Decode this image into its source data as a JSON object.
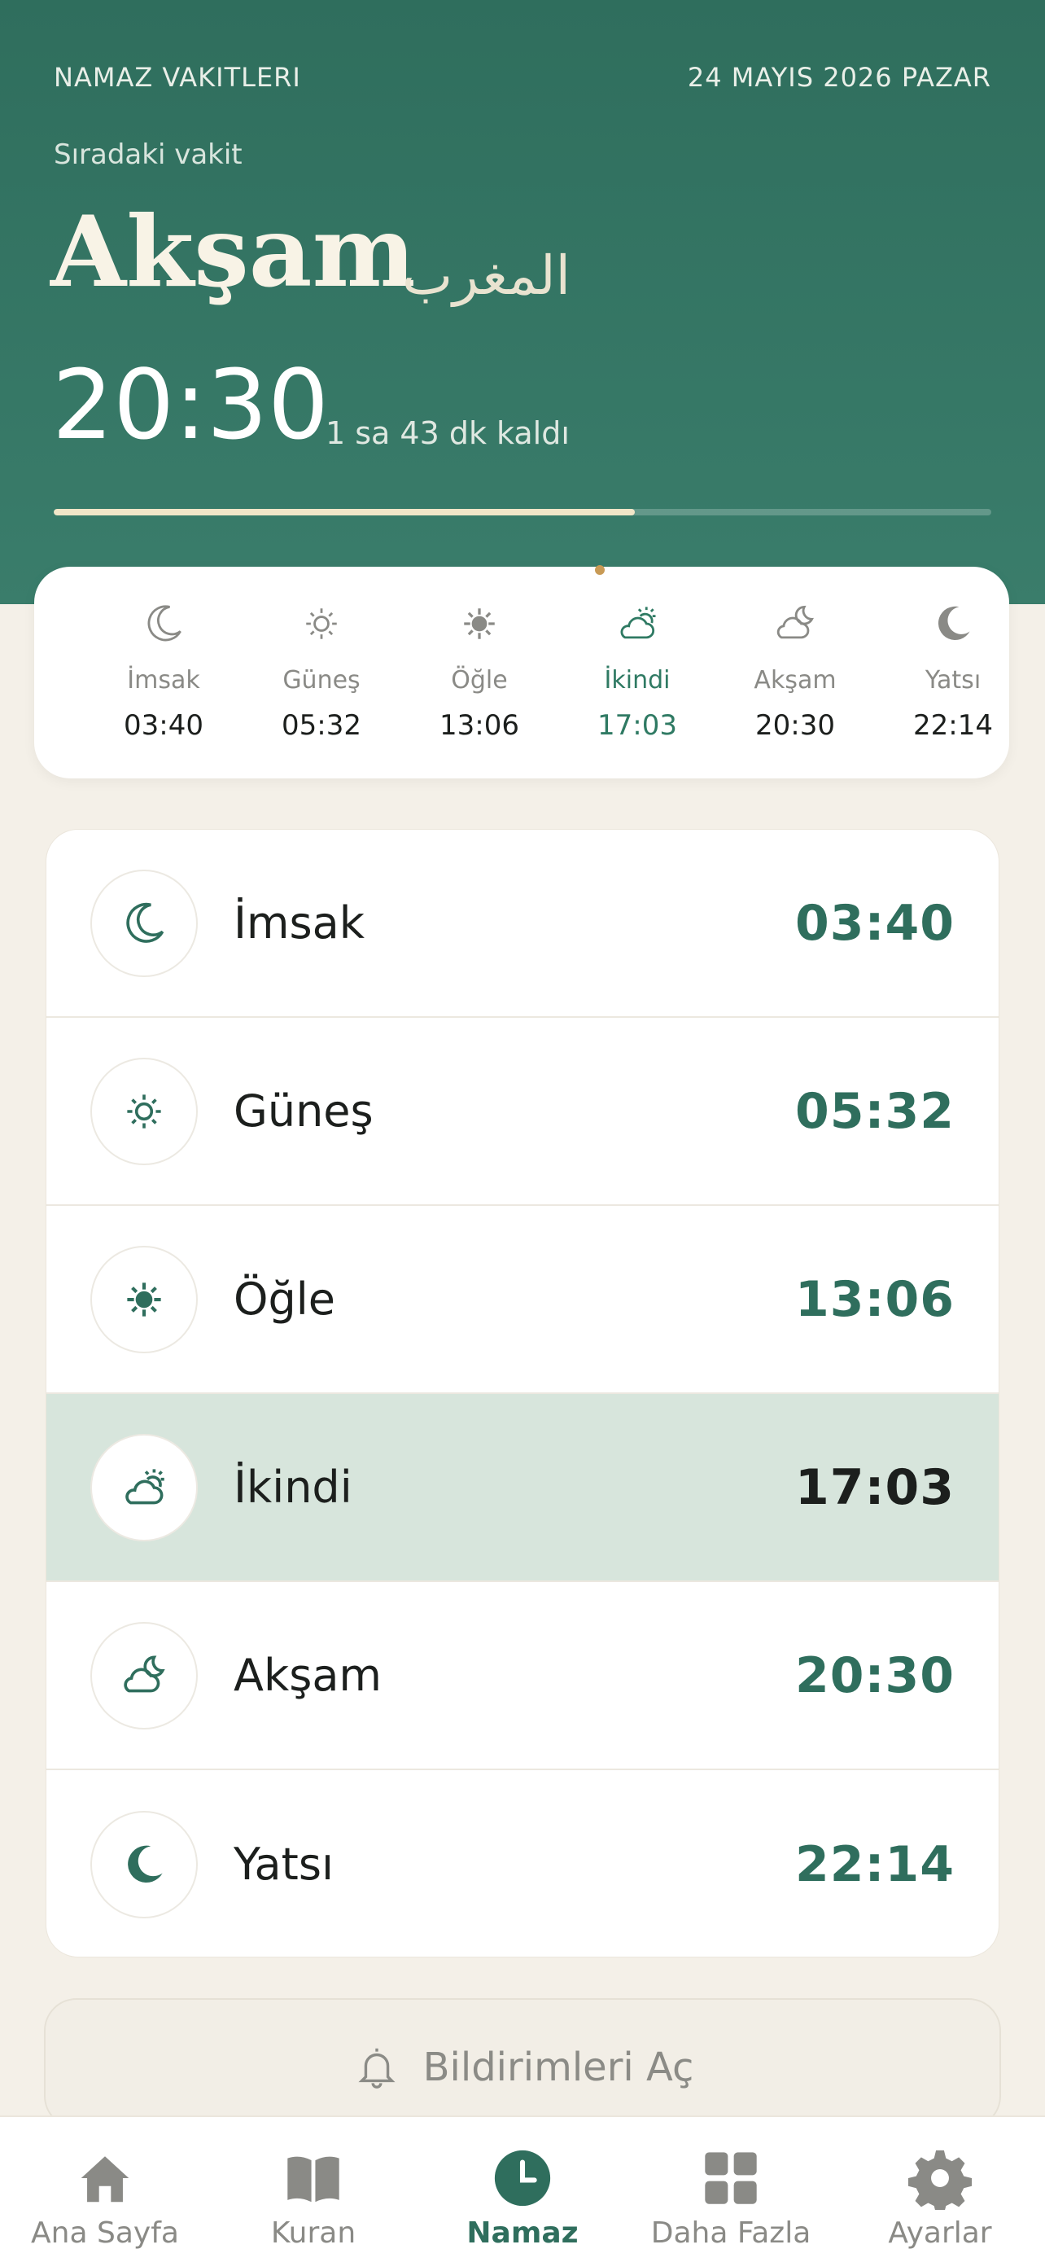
{
  "header": {
    "app_title": "NAMAZ VAKITLERI",
    "date": "24 MAYIS 2026 PAZAR",
    "next_label": "Sıradaki vakit",
    "next_name": "Akşam",
    "next_arabic": "المغرب",
    "next_time": "20:30",
    "remaining": "1 sa 43 dk kaldı",
    "progress_fraction": 0.62
  },
  "summary": [
    {
      "name": "İmsak",
      "time": "03:40",
      "icon": "crescent-moon-icon"
    },
    {
      "name": "Güneş",
      "time": "05:32",
      "icon": "sunrise-icon"
    },
    {
      "name": "Öğle",
      "time": "13:06",
      "icon": "sun-icon"
    },
    {
      "name": "İkindi",
      "time": "17:03",
      "icon": "cloud-sun-icon",
      "active": true
    },
    {
      "name": "Akşam",
      "time": "20:30",
      "icon": "cloud-moon-icon"
    },
    {
      "name": "Yatsı",
      "time": "22:14",
      "icon": "filled-moon-icon"
    }
  ],
  "prayers": [
    {
      "name": "İmsak",
      "time": "03:40",
      "icon": "crescent-moon-icon"
    },
    {
      "name": "Güneş",
      "time": "05:32",
      "icon": "sunrise-icon"
    },
    {
      "name": "Öğle",
      "time": "13:06",
      "icon": "sun-icon"
    },
    {
      "name": "İkindi",
      "time": "17:03",
      "icon": "cloud-sun-icon",
      "active": true
    },
    {
      "name": "Akşam",
      "time": "20:30",
      "icon": "cloud-moon-icon"
    },
    {
      "name": "Yatsı",
      "time": "22:14",
      "icon": "filled-moon-icon"
    }
  ],
  "notify": {
    "label": "Bildirimleri Aç",
    "icon": "bell-icon"
  },
  "tabs": [
    {
      "label": "Ana Sayfa",
      "icon": "home-icon"
    },
    {
      "label": "Kuran",
      "icon": "book-icon"
    },
    {
      "label": "Namaz",
      "icon": "clock-icon",
      "active": true
    },
    {
      "label": "Daha Fazla",
      "icon": "grid-icon"
    },
    {
      "label": "Ayarlar",
      "icon": "gear-icon"
    }
  ],
  "colors": {
    "primary": "#2f6e5d",
    "accent": "#c89a55",
    "background": "#f4f0e8",
    "active_row": "#d7e5dc"
  }
}
